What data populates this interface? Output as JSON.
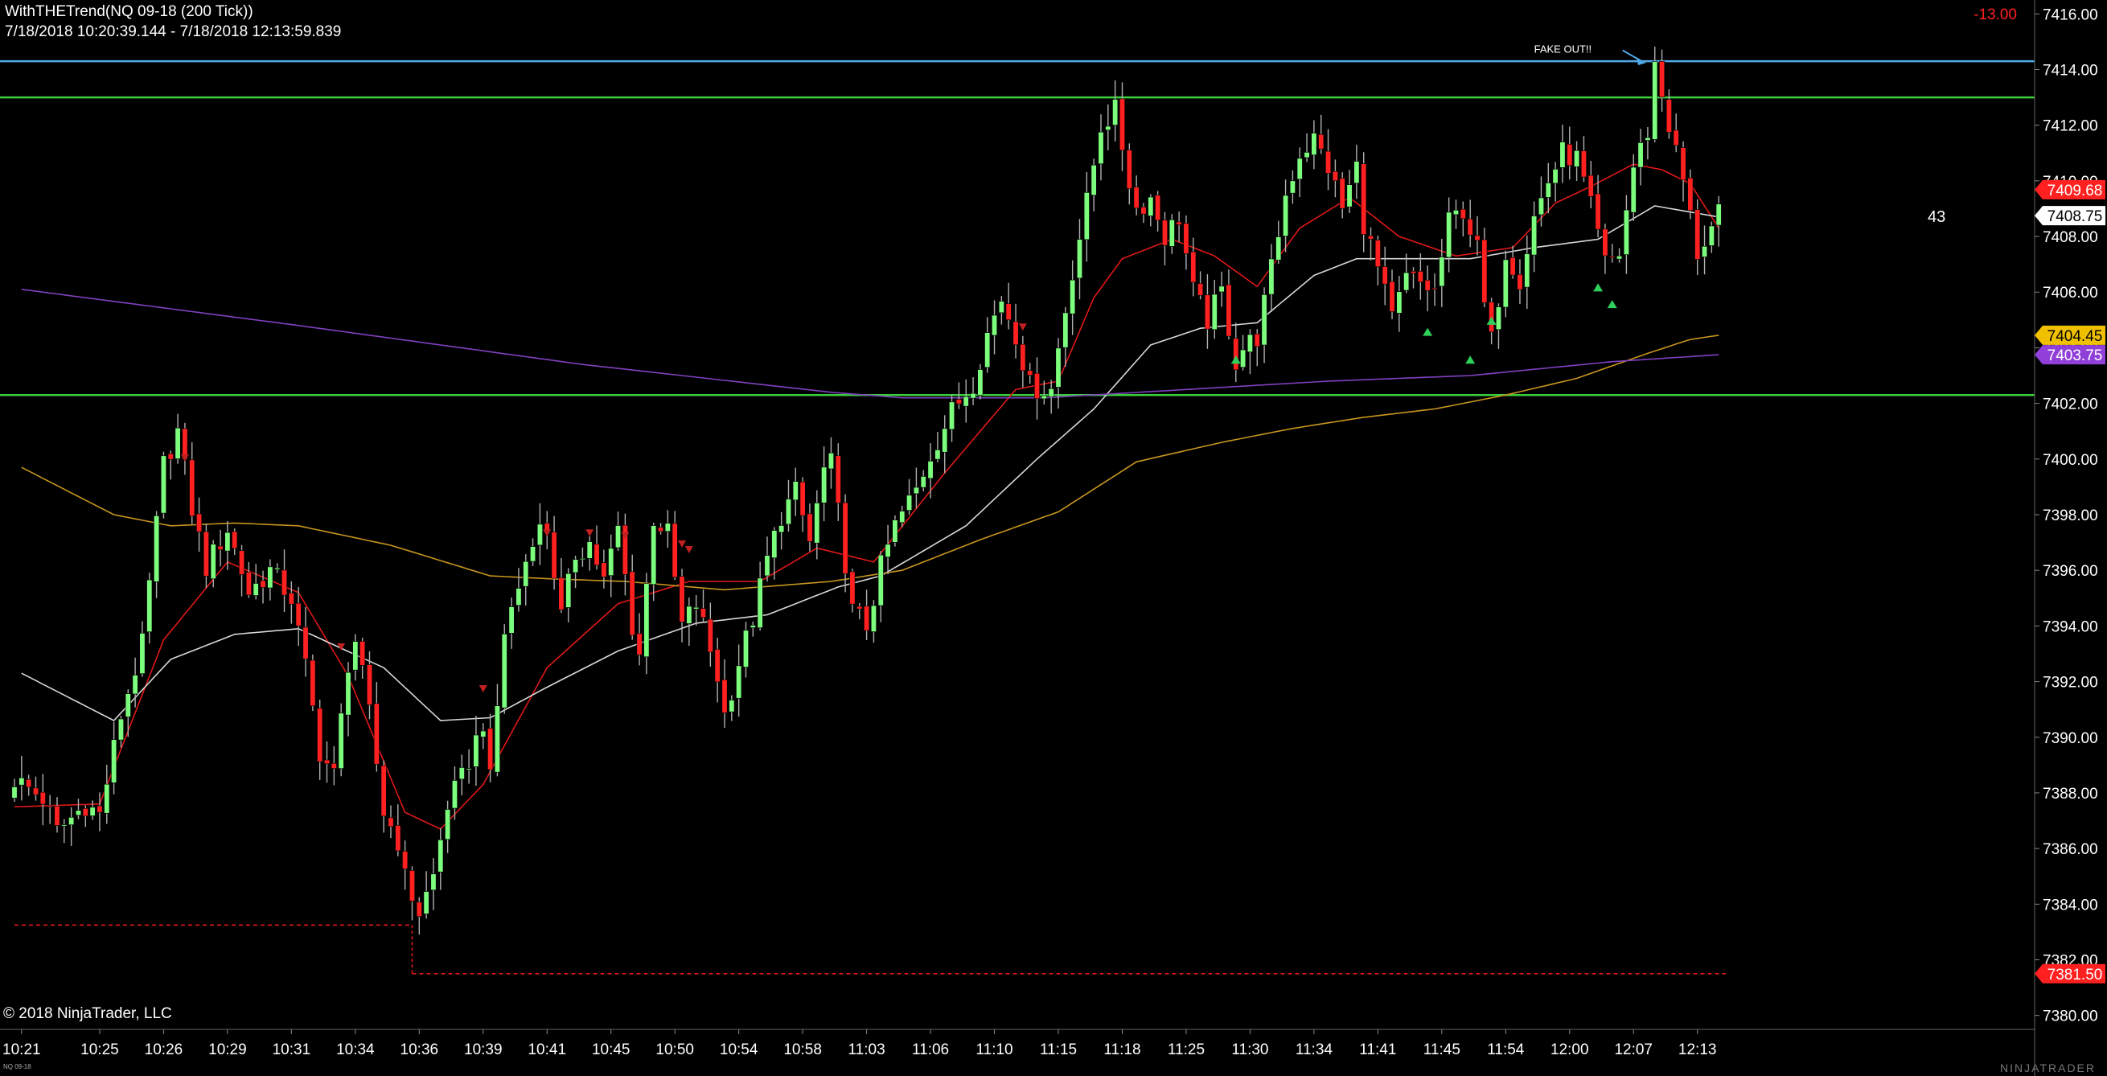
{
  "header": {
    "title": "WithTHETrend(NQ 09-18 (200 Tick))",
    "range": "7/18/2018 10:20:39.144 - 7/18/2018 12:13:59.839",
    "net_change": "-13.00"
  },
  "footer": {
    "copyright": "© 2018 NinjaTrader, LLC",
    "instrument": "NQ 09-18",
    "brand": "NINJATRADER"
  },
  "colors": {
    "background": "#000000",
    "grid": "#151515",
    "bull_candle": "#7cff7c",
    "bear_candle": "#ff2020",
    "ema_fast": "#e01818",
    "sma_mid": "#d8d8d8",
    "sma_slow": "#c8961e",
    "sma_long": "#8040c0",
    "resistance_blue": "#4fa8e8",
    "level_green": "#3ccf3c",
    "stop_red": "#e01818"
  },
  "chart_data": {
    "type": "candlestick",
    "instrument": "NQ 09-18",
    "bar_type": "200 Tick",
    "y_axis": {
      "min": 7379.5,
      "max": 7416.5,
      "ticks": [
        7380,
        7382,
        7384,
        7386,
        7388,
        7390,
        7392,
        7394,
        7396,
        7398,
        7400,
        7402,
        7404,
        7406,
        7408,
        7410,
        7412,
        7414,
        7416
      ],
      "tick_labels": [
        "7380.00",
        "7382.00",
        "7384.00",
        "7386.00",
        "7388.00",
        "7390.00",
        "7392.00",
        "7394.00",
        "7396.00",
        "7398.00",
        "7400.00",
        "7402.00",
        "7404.00",
        "7406.00",
        "7408.00",
        "7410.00",
        "7412.00",
        "7414.00",
        "7416.00"
      ]
    },
    "x_axis": {
      "tick_labels": [
        "10:21",
        "10:25",
        "10:26",
        "10:29",
        "10:31",
        "10:34",
        "10:36",
        "10:39",
        "10:41",
        "10:45",
        "10:50",
        "10:54",
        "10:58",
        "11:03",
        "11:06",
        "11:10",
        "11:15",
        "11:18",
        "11:25",
        "11:30",
        "11:34",
        "11:41",
        "11:45",
        "11:54",
        "12:00",
        "12:07",
        "12:13"
      ],
      "tick_bar_index": [
        1,
        12,
        21,
        30,
        39,
        48,
        57,
        66,
        75,
        84,
        93,
        102,
        111,
        120,
        129,
        138,
        147,
        156,
        165,
        174,
        183,
        192,
        201,
        210,
        219,
        228,
        237
      ]
    },
    "bar_count": 241,
    "candle_anchors": [
      [
        0,
        7388.5
      ],
      [
        4,
        7387.8
      ],
      [
        6,
        7386.6
      ],
      [
        10,
        7387.6
      ],
      [
        12,
        7387.2
      ],
      [
        15,
        7390.8
      ],
      [
        18,
        7393.3
      ],
      [
        21,
        7399.8
      ],
      [
        23,
        7401.0
      ],
      [
        25,
        7398.2
      ],
      [
        27,
        7396.1
      ],
      [
        30,
        7397.5
      ],
      [
        33,
        7395.2
      ],
      [
        36,
        7396.0
      ],
      [
        39,
        7395.0
      ],
      [
        41,
        7392.5
      ],
      [
        43,
        7389.5
      ],
      [
        45,
        7388.6
      ],
      [
        47,
        7392.7
      ],
      [
        48,
        7393.5
      ],
      [
        50,
        7390.8
      ],
      [
        52,
        7387.3
      ],
      [
        54,
        7386.3
      ],
      [
        55,
        7384.9
      ],
      [
        57,
        7383.7
      ],
      [
        59,
        7385.0
      ],
      [
        61,
        7387.6
      ],
      [
        63,
        7388.5
      ],
      [
        66,
        7390.6
      ],
      [
        67,
        7388.4
      ],
      [
        69,
        7393.8
      ],
      [
        71,
        7395.4
      ],
      [
        73,
        7397.3
      ],
      [
        75,
        7397.6
      ],
      [
        77,
        7394.3
      ],
      [
        79,
        7396.6
      ],
      [
        81,
        7397.0
      ],
      [
        83,
        7395.6
      ],
      [
        85,
        7397.5
      ],
      [
        87,
        7394.0
      ],
      [
        88,
        7393.0
      ],
      [
        90,
        7397.9
      ],
      [
        92,
        7397.3
      ],
      [
        94,
        7394.0
      ],
      [
        96,
        7394.8
      ],
      [
        97,
        7394.0
      ],
      [
        99,
        7392.2
      ],
      [
        100,
        7390.8
      ],
      [
        102,
        7392.7
      ],
      [
        104,
        7394.3
      ],
      [
        106,
        7396.4
      ],
      [
        108,
        7398.0
      ],
      [
        110,
        7398.8
      ],
      [
        112,
        7397.0
      ],
      [
        114,
        7399.6
      ],
      [
        115,
        7399.8
      ],
      [
        117,
        7396.3
      ],
      [
        118,
        7394.5
      ],
      [
        120,
        7394.0
      ],
      [
        122,
        7396.1
      ],
      [
        124,
        7397.6
      ],
      [
        127,
        7398.9
      ],
      [
        129,
        7400.2
      ],
      [
        132,
        7401.7
      ],
      [
        135,
        7402.8
      ],
      [
        137,
        7404.5
      ],
      [
        139,
        7405.8
      ],
      [
        141,
        7404.5
      ],
      [
        143,
        7402.6
      ],
      [
        146,
        7402.5
      ],
      [
        147,
        7404.0
      ],
      [
        149,
        7406.8
      ],
      [
        151,
        7409.2
      ],
      [
        153,
        7412.0
      ],
      [
        155,
        7412.5
      ],
      [
        157,
        7410.0
      ],
      [
        158,
        7409.0
      ],
      [
        160,
        7409.4
      ],
      [
        162,
        7408.0
      ],
      [
        164,
        7408.7
      ],
      [
        166,
        7406.0
      ],
      [
        168,
        7405.0
      ],
      [
        170,
        7406.0
      ],
      [
        172,
        7403.5
      ],
      [
        173,
        7404.0
      ],
      [
        175,
        7404.4
      ],
      [
        177,
        7406.8
      ],
      [
        179,
        7409.5
      ],
      [
        181,
        7411.0
      ],
      [
        183,
        7411.5
      ],
      [
        185,
        7410.5
      ],
      [
        187,
        7409.0
      ],
      [
        189,
        7410.5
      ],
      [
        190,
        7408.5
      ],
      [
        192,
        7406.8
      ],
      [
        194,
        7405.0
      ],
      [
        196,
        7406.5
      ],
      [
        198,
        7406.3
      ],
      [
        200,
        7406.0
      ],
      [
        202,
        7408.5
      ],
      [
        204,
        7409.0
      ],
      [
        206,
        7407.5
      ],
      [
        207,
        7405.5
      ],
      [
        208,
        7404.2
      ],
      [
        210,
        7407.5
      ],
      [
        212,
        7406.5
      ],
      [
        214,
        7408.7
      ],
      [
        216,
        7410.0
      ],
      [
        218,
        7411.0
      ],
      [
        220,
        7410.8
      ],
      [
        222,
        7409.0
      ],
      [
        224,
        7407.0
      ],
      [
        226,
        7407.4
      ],
      [
        228,
        7410.5
      ],
      [
        230,
        7411.8
      ],
      [
        231,
        7414.2
      ],
      [
        233,
        7412.0
      ],
      [
        235,
        7410.0
      ],
      [
        237,
        7407.4
      ],
      [
        239,
        7408.3
      ],
      [
        240,
        7408.75
      ]
    ],
    "series": [
      {
        "name": "ema_fast",
        "anchors": [
          [
            0,
            7387.5
          ],
          [
            12,
            7387.6
          ],
          [
            21,
            7393.5
          ],
          [
            30,
            7396.3
          ],
          [
            40,
            7395.2
          ],
          [
            47,
            7392.2
          ],
          [
            55,
            7387.3
          ],
          [
            60,
            7386.7
          ],
          [
            66,
            7388.3
          ],
          [
            75,
            7392.5
          ],
          [
            85,
            7394.8
          ],
          [
            95,
            7395.6
          ],
          [
            105,
            7395.6
          ],
          [
            113,
            7396.8
          ],
          [
            121,
            7396.3
          ],
          [
            131,
            7399.5
          ],
          [
            141,
            7402.5
          ],
          [
            147,
            7402.8
          ],
          [
            152,
            7405.8
          ],
          [
            156,
            7407.2
          ],
          [
            163,
            7407.9
          ],
          [
            169,
            7407.3
          ],
          [
            175,
            7406.2
          ],
          [
            181,
            7408.3
          ],
          [
            188,
            7409.4
          ],
          [
            195,
            7408.0
          ],
          [
            203,
            7407.3
          ],
          [
            211,
            7407.6
          ],
          [
            217,
            7409.2
          ],
          [
            222,
            7409.8
          ],
          [
            228,
            7410.6
          ],
          [
            232,
            7410.4
          ],
          [
            236,
            7409.9
          ],
          [
            240,
            7408.3
          ]
        ]
      },
      {
        "name": "sma_mid",
        "anchors": [
          [
            1,
            7392.3
          ],
          [
            14,
            7390.6
          ],
          [
            22,
            7392.8
          ],
          [
            31,
            7393.7
          ],
          [
            40,
            7393.9
          ],
          [
            52,
            7392.5
          ],
          [
            60,
            7390.6
          ],
          [
            67,
            7390.7
          ],
          [
            75,
            7391.8
          ],
          [
            85,
            7393.1
          ],
          [
            96,
            7394.1
          ],
          [
            106,
            7394.4
          ],
          [
            116,
            7395.4
          ],
          [
            122,
            7395.8
          ],
          [
            134,
            7397.6
          ],
          [
            144,
            7400.0
          ],
          [
            152,
            7401.8
          ],
          [
            160,
            7404.1
          ],
          [
            167,
            7404.7
          ],
          [
            175,
            7404.9
          ],
          [
            183,
            7406.6
          ],
          [
            189,
            7407.2
          ],
          [
            195,
            7407.2
          ],
          [
            205,
            7407.2
          ],
          [
            214,
            7407.6
          ],
          [
            223,
            7407.9
          ],
          [
            231,
            7409.1
          ],
          [
            240,
            7408.7
          ]
        ]
      },
      {
        "name": "sma_slow",
        "anchors": [
          [
            1,
            7399.7
          ],
          [
            14,
            7398.0
          ],
          [
            22,
            7397.6
          ],
          [
            31,
            7397.7
          ],
          [
            40,
            7397.6
          ],
          [
            53,
            7396.9
          ],
          [
            67,
            7395.8
          ],
          [
            75,
            7395.7
          ],
          [
            86,
            7395.6
          ],
          [
            100,
            7395.3
          ],
          [
            115,
            7395.6
          ],
          [
            125,
            7396.0
          ],
          [
            136,
            7397.1
          ],
          [
            147,
            7398.1
          ],
          [
            158,
            7399.9
          ],
          [
            170,
            7400.6
          ],
          [
            180,
            7401.1
          ],
          [
            190,
            7401.5
          ],
          [
            200,
            7401.8
          ],
          [
            210,
            7402.3
          ],
          [
            220,
            7402.9
          ],
          [
            230,
            7403.8
          ],
          [
            236,
            7404.3
          ],
          [
            240,
            7404.45
          ]
        ]
      },
      {
        "name": "sma_long",
        "anchors": [
          [
            1,
            7406.1
          ],
          [
            40,
            7404.8
          ],
          [
            80,
            7403.4
          ],
          [
            115,
            7402.4
          ],
          [
            125,
            7402.2
          ],
          [
            145,
            7402.2
          ],
          [
            165,
            7402.5
          ],
          [
            185,
            7402.8
          ],
          [
            205,
            7403.0
          ],
          [
            225,
            7403.5
          ],
          [
            240,
            7403.75
          ]
        ]
      }
    ],
    "horizontal_lines": [
      {
        "name": "resistance_blue",
        "value": 7414.3,
        "color": "#4fa8e8"
      },
      {
        "name": "upper_green",
        "value": 7413.0,
        "color": "#3ccf3c"
      },
      {
        "name": "lower_green",
        "value": 7402.3,
        "color": "#3ccf3c"
      }
    ],
    "stop_lines": [
      {
        "value": 7383.25,
        "from_bar": 0,
        "to_bar": 56
      },
      {
        "value": 7381.5,
        "from_bar": 56,
        "to_bar": 241
      }
    ],
    "sell_markers": [
      [
        24,
        7400.0
      ],
      [
        46,
        7393.2
      ],
      [
        66,
        7391.7
      ],
      [
        75,
        7397.3
      ],
      [
        81,
        7397.3
      ],
      [
        86,
        7397.2
      ],
      [
        94,
        7396.9
      ],
      [
        95,
        7396.7
      ],
      [
        142,
        7404.7
      ]
    ],
    "buy_markers": [
      [
        172,
        7403.6
      ],
      [
        199,
        7404.6
      ],
      [
        205,
        7403.6
      ],
      [
        208,
        7405.0
      ],
      [
        223,
        7406.2
      ],
      [
        225,
        7405.6
      ]
    ],
    "price_labels": [
      {
        "text": "7409.68",
        "value": 7409.68,
        "bg": "#ff2020",
        "fg": "#ffffff"
      },
      {
        "text": "7408.75",
        "value": 7408.75,
        "bg": "#ffffff",
        "fg": "#000000"
      },
      {
        "text": "7404.45",
        "value": 7404.45,
        "bg": "#f0c000",
        "fg": "#000000"
      },
      {
        "text": "7403.75",
        "value": 7403.75,
        "bg": "#9040d8",
        "fg": "#ffffff"
      },
      {
        "text": "7381.50",
        "value": 7381.5,
        "bg": "#ff2020",
        "fg": "#ffffff"
      }
    ],
    "annotations": [
      {
        "text": "FAKE OUT!!",
        "value": 7414.75,
        "bar": 214,
        "arrow_to_bar": 230,
        "arrow_to_value": 7414.3
      },
      {
        "text": "43",
        "value": 7408.7,
        "bar": 242
      }
    ]
  }
}
